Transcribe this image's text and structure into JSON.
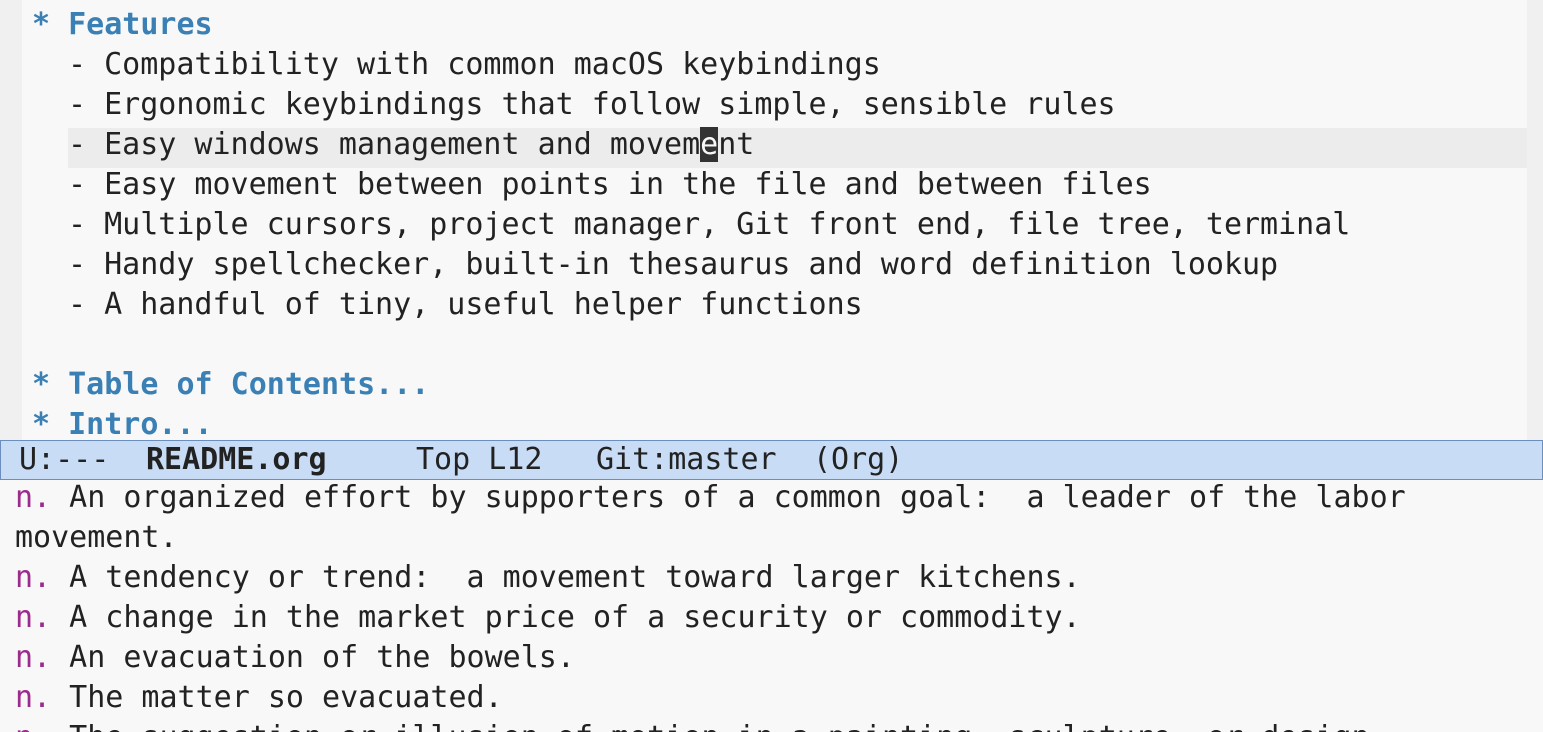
{
  "editor": {
    "features_heading": "* Features",
    "items": [
      "- Compatibility with common macOS keybindings",
      "- Ergonomic keybindings that follow simple, sensible rules",
      "- Easy windows management and movement",
      "- Easy movement between points in the file and between files",
      "- Multiple cursors, project manager, Git front end, file tree, terminal",
      "- Handy spellchecker, built-in thesaurus and word definition lookup",
      "- A handful of tiny, useful helper functions"
    ],
    "current_line": {
      "before_cursor": "- Easy windows management and movem",
      "cursor_char": "e",
      "after_cursor": "nt"
    },
    "toc_heading": "* Table of Contents...",
    "intro_heading": "* Intro..."
  },
  "modeline": {
    "status": "U:---",
    "buffer": "README.org",
    "position": "Top L12",
    "vc": "Git:master",
    "mode": "(Org)"
  },
  "dictionary": {
    "pos_label": "n.",
    "lines": [
      {
        "pos": "n.",
        "text": " An organized effort by supporters of a common goal:  a leader of the labor"
      },
      {
        "pos": "",
        "text": "movement."
      },
      {
        "pos": "n.",
        "text": " A tendency or trend:  a movement toward larger kitchens."
      },
      {
        "pos": "n.",
        "text": " A change in the market price of a security or commodity."
      },
      {
        "pos": "n.",
        "text": " An evacuation of the bowels."
      },
      {
        "pos": "n.",
        "text": " The matter so evacuated."
      },
      {
        "pos": "n.",
        "text": " The suggestion or illusion of motion in a painting, sculpture, or design."
      }
    ]
  },
  "colors": {
    "heading": "#3a80b5",
    "pos_label": "#9c2b8e",
    "modeline_bg": "#c8dcf5",
    "background": "#f8f8f8"
  }
}
